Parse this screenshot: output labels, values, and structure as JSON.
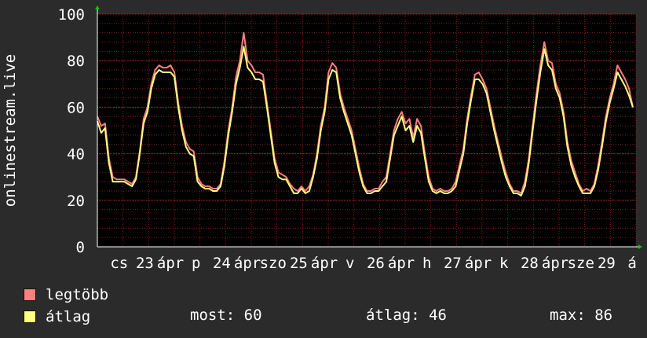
{
  "chart_data": {
    "type": "line",
    "ylabel": "onlinestream.live",
    "ylim": [
      0,
      100
    ],
    "yticks": [
      0,
      20,
      40,
      60,
      80,
      100
    ],
    "x_tick_labels": [
      "cs",
      "23",
      "ápr",
      "p",
      "24",
      "ápr",
      "szo",
      "25",
      "ápr",
      "v",
      "26",
      "ápr",
      "h",
      "27",
      "ápr",
      "k",
      "28",
      "ápr",
      "sze",
      "29",
      "á"
    ],
    "grid": true,
    "background": "#000000",
    "gridColor": "#8b1a1a",
    "series": [
      {
        "name": "legtöbb",
        "color": "#ff7f7f",
        "values": [
          56,
          52,
          53,
          38,
          30,
          29,
          29,
          29,
          28,
          27,
          30,
          41,
          55,
          60,
          70,
          76,
          78,
          77,
          77,
          78,
          75,
          62,
          52,
          45,
          42,
          41,
          30,
          27,
          26,
          26,
          25,
          25,
          27,
          37,
          50,
          60,
          73,
          80,
          92,
          80,
          78,
          75,
          75,
          74,
          62,
          50,
          38,
          32,
          31,
          30,
          27,
          25,
          24,
          26,
          24,
          26,
          31,
          40,
          52,
          60,
          75,
          79,
          77,
          66,
          60,
          55,
          50,
          42,
          34,
          27,
          24,
          24,
          25,
          25,
          28,
          30,
          40,
          50,
          55,
          58,
          53,
          55,
          47,
          55,
          52,
          40,
          30,
          25,
          24,
          25,
          24,
          24,
          25,
          28,
          35,
          42,
          55,
          65,
          74,
          75,
          72,
          68,
          60,
          52,
          45,
          38,
          32,
          27,
          24,
          24,
          23,
          28,
          38,
          52,
          66,
          78,
          88,
          80,
          79,
          70,
          66,
          58,
          45,
          37,
          32,
          27,
          24,
          25,
          24,
          27,
          35,
          45,
          56,
          64,
          70,
          78,
          75,
          72,
          68,
          60
        ]
      },
      {
        "name": "átlag",
        "color": "#ffff7f",
        "values": [
          54,
          49,
          51,
          36,
          28,
          28,
          28,
          28,
          27,
          26,
          29,
          40,
          53,
          58,
          68,
          74,
          76,
          75,
          75,
          75,
          73,
          60,
          50,
          43,
          40,
          39,
          28,
          26,
          25,
          25,
          24,
          24,
          26,
          35,
          48,
          58,
          70,
          77,
          86,
          77,
          75,
          72,
          72,
          71,
          60,
          48,
          36,
          30,
          29,
          29,
          26,
          23,
          23,
          25,
          23,
          24,
          30,
          38,
          50,
          58,
          72,
          76,
          75,
          64,
          58,
          53,
          48,
          40,
          32,
          26,
          23,
          23,
          24,
          24,
          26,
          28,
          38,
          48,
          52,
          56,
          50,
          52,
          45,
          52,
          49,
          38,
          28,
          24,
          23,
          24,
          23,
          23,
          24,
          26,
          33,
          40,
          53,
          63,
          72,
          72,
          70,
          66,
          58,
          50,
          43,
          36,
          30,
          26,
          23,
          23,
          22,
          26,
          36,
          50,
          63,
          75,
          85,
          78,
          76,
          68,
          64,
          56,
          43,
          35,
          30,
          26,
          23,
          23,
          23,
          26,
          33,
          43,
          54,
          62,
          68,
          75,
          72,
          69,
          65,
          60
        ]
      }
    ],
    "legend": {
      "entries": [
        {
          "label": "legtöbb",
          "color": "#ff7f7f"
        },
        {
          "label": "átlag",
          "color": "#ffff7f"
        }
      ],
      "placement": "bottom-left"
    },
    "stats": {
      "current_label": "most:",
      "current_value": "60",
      "average_label": "átlag:",
      "average_value": "46",
      "max_label": "max:",
      "max_value": "86"
    }
  }
}
